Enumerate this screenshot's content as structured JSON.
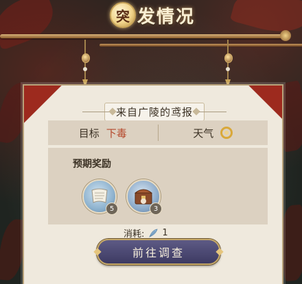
{
  "title": {
    "seal_char": "突",
    "text": "发情况"
  },
  "card": {
    "source": "来自广陵的鸢报",
    "target_label": "目标",
    "target_value": "下毒",
    "weather_label": "天气",
    "weather_icon": "sun-ring-icon",
    "rewards_title": "预期奖励",
    "rewards": [
      {
        "icon": "scroll-icon",
        "count": "5"
      },
      {
        "icon": "treasure-chest-icon",
        "count": "3"
      }
    ],
    "cost_label": "消耗:",
    "cost_icon": "feather-icon",
    "cost_value": "1",
    "go_button_label": "前往调查"
  },
  "colors": {
    "accent_red": "#b5472a",
    "button_bg": "#4d4a74",
    "gold": "#c5a868"
  }
}
